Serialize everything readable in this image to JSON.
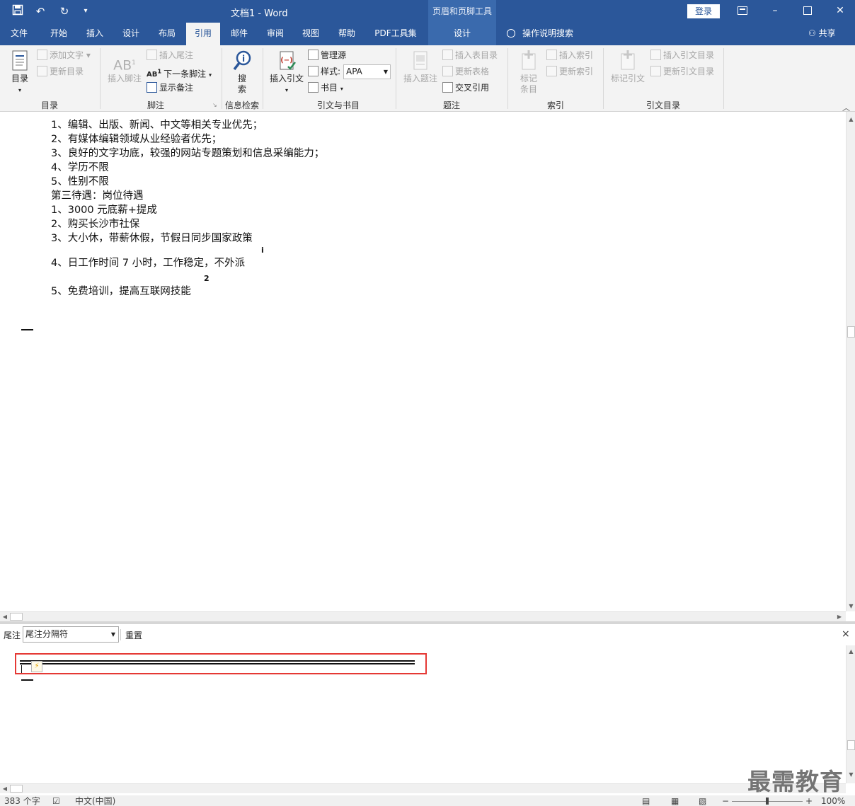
{
  "window": {
    "title": "文档1  -  Word",
    "context_tab_title": "页眉和页脚工具",
    "login_label": "登录",
    "colors": {
      "titlebar": "#2b579a",
      "highlight": "#e53935"
    }
  },
  "quick_access": {
    "icons": [
      "save-icon",
      "undo-icon",
      "redo-icon",
      "customize-icon"
    ]
  },
  "tabs": [
    {
      "label": "文件"
    },
    {
      "label": "开始"
    },
    {
      "label": "插入"
    },
    {
      "label": "设计"
    },
    {
      "label": "布局"
    },
    {
      "label": "引用"
    },
    {
      "label": "邮件"
    },
    {
      "label": "审阅"
    },
    {
      "label": "视图"
    },
    {
      "label": "帮助"
    },
    {
      "label": "PDF工具集"
    },
    {
      "label": "设计"
    }
  ],
  "tell_me": "操作说明搜索",
  "share": "共享",
  "ribbon": {
    "toc": {
      "big": "目录",
      "add_text": "添加文字",
      "update": "更新目录",
      "label": "目录"
    },
    "footnotes": {
      "insert_footnote": "插入脚注",
      "insert_endnote": "插入尾注",
      "next_footnote": "下一条脚注",
      "show_notes": "显示备注",
      "label": "脚注"
    },
    "research": {
      "big_line1": "搜",
      "big_line2": "索",
      "label": "信息检索"
    },
    "citations": {
      "insert_citation": "插入引文",
      "manage_sources": "管理源",
      "style_label": "样式:",
      "style_value": "APA",
      "bibliography": "书目",
      "label": "引文与书目"
    },
    "captions": {
      "insert_caption": "插入题注",
      "insert_table_of_figures": "插入表目录",
      "update_table": "更新表格",
      "cross_reference": "交叉引用",
      "label": "题注"
    },
    "index": {
      "mark_entry_line1": "标记",
      "mark_entry_line2": "条目",
      "insert_index": "插入索引",
      "update_index": "更新索引",
      "label": "索引"
    },
    "toa": {
      "mark_citation": "标记引文",
      "insert_toa": "插入引文目录",
      "update_toa": "更新引文目录",
      "label": "引文目录"
    }
  },
  "document": {
    "lines": [
      "1、编辑、出版、新闻、中文等相关专业优先；",
      "2、有媒体编辑领域从业经验者优先；",
      "3、良好的文字功底，较强的网站专题策划和信息采编能力；",
      "4、学历不限",
      "5、性别不限",
      "第三待遇：岗位待遇",
      "1、3000 元底薪+提成",
      "2、购买长沙市社保",
      "3、大小休，带薪休假，节假日同步国家政策",
      "4、日工作时间 7 小时，工作稳定，不外派",
      "5、免费培训，提高互联网技能"
    ],
    "note_refs": [
      "i",
      "2"
    ]
  },
  "note_pane": {
    "label": "尾注",
    "select_value": "尾注分隔符",
    "reset": "重置",
    "close": "×"
  },
  "watermark": "最需教育",
  "status": {
    "word_count": "383 个字",
    "language": "中文(中国)",
    "zoom": "100%"
  }
}
